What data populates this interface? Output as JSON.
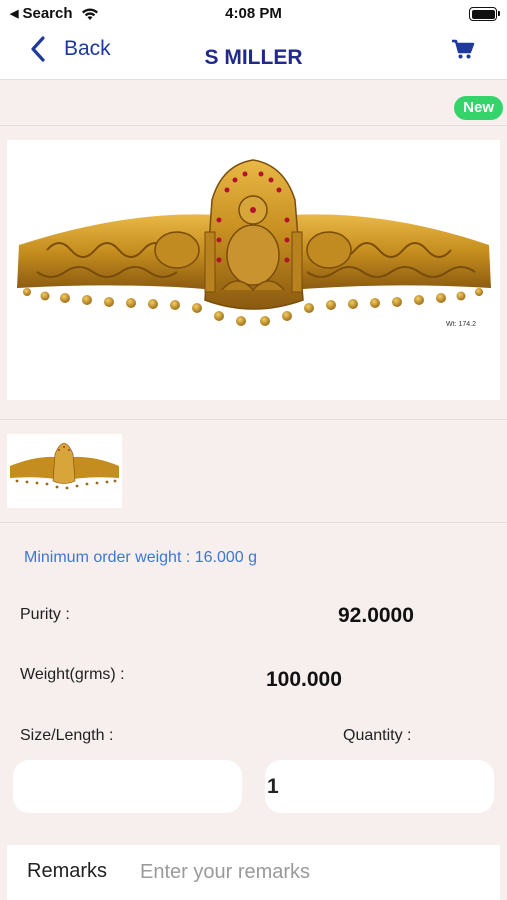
{
  "status_bar": {
    "back_app": "Search",
    "time": "4:08 PM"
  },
  "nav": {
    "back_label": "Back",
    "title": "S MILLER",
    "cart_icon": "cart-icon",
    "accent_color": "#1f3a9c"
  },
  "badge": {
    "label": "New",
    "color": "#35d46a"
  },
  "product": {
    "image_alt": "Gold temple waist belt (vaddanam) with Lakshmi motif",
    "image_weight_caption": "Wt: 174.2"
  },
  "details": {
    "min_order": "Minimum order weight : 16.000 g",
    "purity_label": "Purity :",
    "purity_value": "92.0000",
    "weight_label": "Weight(grms) :",
    "weight_value": "100.000",
    "size_label": "Size/Length :",
    "size_value": "",
    "quantity_label": "Quantity :",
    "quantity_value": "1",
    "remarks_label": "Remarks",
    "remarks_placeholder": "Enter your remarks"
  }
}
